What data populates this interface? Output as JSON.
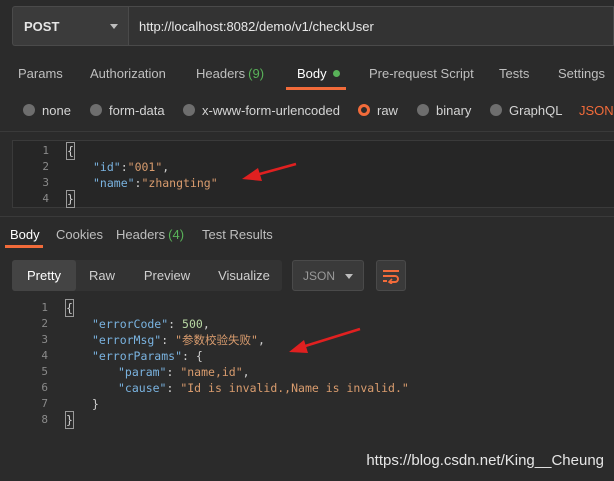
{
  "request": {
    "method": "POST",
    "url": "http://localhost:8082/demo/v1/checkUser"
  },
  "request_tabs": {
    "params": "Params",
    "authorization": "Authorization",
    "headers": "Headers",
    "headers_count": "(9)",
    "body": "Body",
    "prerequest": "Pre-request Script",
    "tests": "Tests",
    "settings": "Settings"
  },
  "body_types": {
    "none": "none",
    "form_data": "form-data",
    "urlencoded": "x-www-form-urlencoded",
    "raw": "raw",
    "binary": "binary",
    "graphql": "GraphQL",
    "json": "JSON"
  },
  "request_body": {
    "line_numbers": [
      "1",
      "2",
      "3",
      "4"
    ],
    "open": "{",
    "id_key": "\"id\"",
    "id_value": "\"001\"",
    "name_key": "\"name\"",
    "name_value": "\"zhangting\"",
    "close": "}"
  },
  "response_tabs": {
    "body": "Body",
    "cookies": "Cookies",
    "headers": "Headers",
    "headers_count": "(4)",
    "test_results": "Test Results"
  },
  "view_modes": {
    "pretty": "Pretty",
    "raw": "Raw",
    "preview": "Preview",
    "visualize": "Visualize",
    "format": "JSON"
  },
  "response_body": {
    "line_numbers": [
      "1",
      "2",
      "3",
      "4",
      "5",
      "6",
      "7",
      "8"
    ],
    "open": "{",
    "errorCode_key": "\"errorCode\"",
    "errorCode_value": "500",
    "errorMsg_key": "\"errorMsg\"",
    "errorMsg_value": "\"参数校验失败\"",
    "errorParams_key": "\"errorParams\"",
    "param_key": "\"param\"",
    "param_value": "\"name,id\"",
    "cause_key": "\"cause\"",
    "cause_value": "\"Id is invalid.,Name is invalid.\"",
    "inner_close": "}",
    "close": "}"
  },
  "watermark": "https://blog.csdn.net/King__Cheung",
  "colors": {
    "accent": "#f26b3a",
    "success": "#59b259",
    "arrow": "#e02020"
  },
  "icons": [
    "chevron-down-icon",
    "wrap-lines-icon",
    "arrow-annotation"
  ]
}
